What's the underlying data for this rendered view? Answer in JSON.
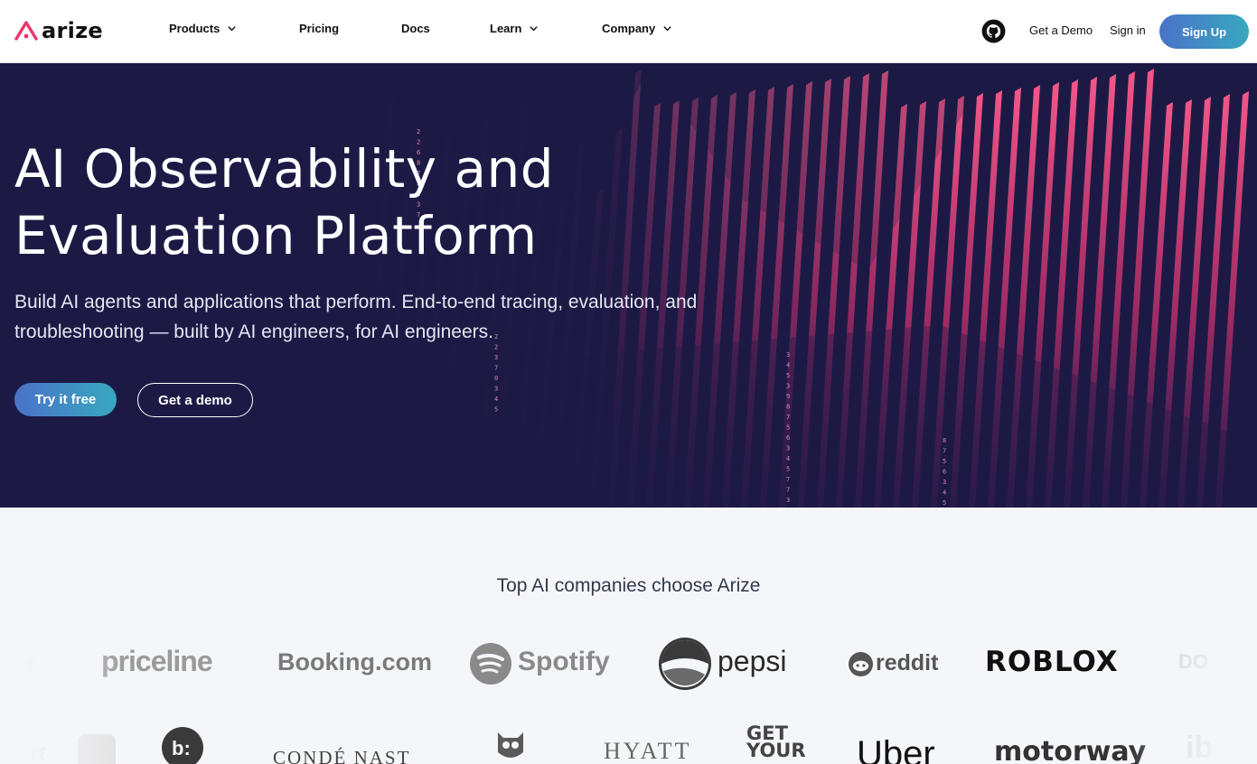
{
  "nav": {
    "logo_text": "arize",
    "items": [
      {
        "label": "Products",
        "has_dropdown": true
      },
      {
        "label": "Pricing",
        "has_dropdown": false
      },
      {
        "label": "Docs",
        "has_dropdown": false
      },
      {
        "label": "Learn",
        "has_dropdown": true
      },
      {
        "label": "Company",
        "has_dropdown": true
      }
    ],
    "github_icon": "github-icon",
    "get_demo": "Get a Demo",
    "sign_in": "Sign in",
    "sign_up": "Sign Up"
  },
  "hero": {
    "title": "AI Observability and Evaluation Platform",
    "subtitle": "Build AI agents and applications that perform. End-to-end tracing, evaluation, and troubleshooting — built by AI engineers, for AI engineers.",
    "primary_cta": "Try it free",
    "secondary_cta": "Get a demo"
  },
  "customers": {
    "heading": "Top AI companies choose Arize",
    "row1": [
      "priceline",
      "Booking.com",
      "Spotify",
      "pepsi",
      "reddit",
      "ROBLOX"
    ],
    "row2": [
      "CONDÉ NAST",
      "HYATT",
      "GET YOUR",
      "Uber",
      "motorway"
    ]
  },
  "colors": {
    "accent_gradient_start": "#4a72c8",
    "accent_gradient_end": "#38a8c0",
    "hero_bg": "#1c1a45",
    "brand_pink": "#e8386b"
  }
}
